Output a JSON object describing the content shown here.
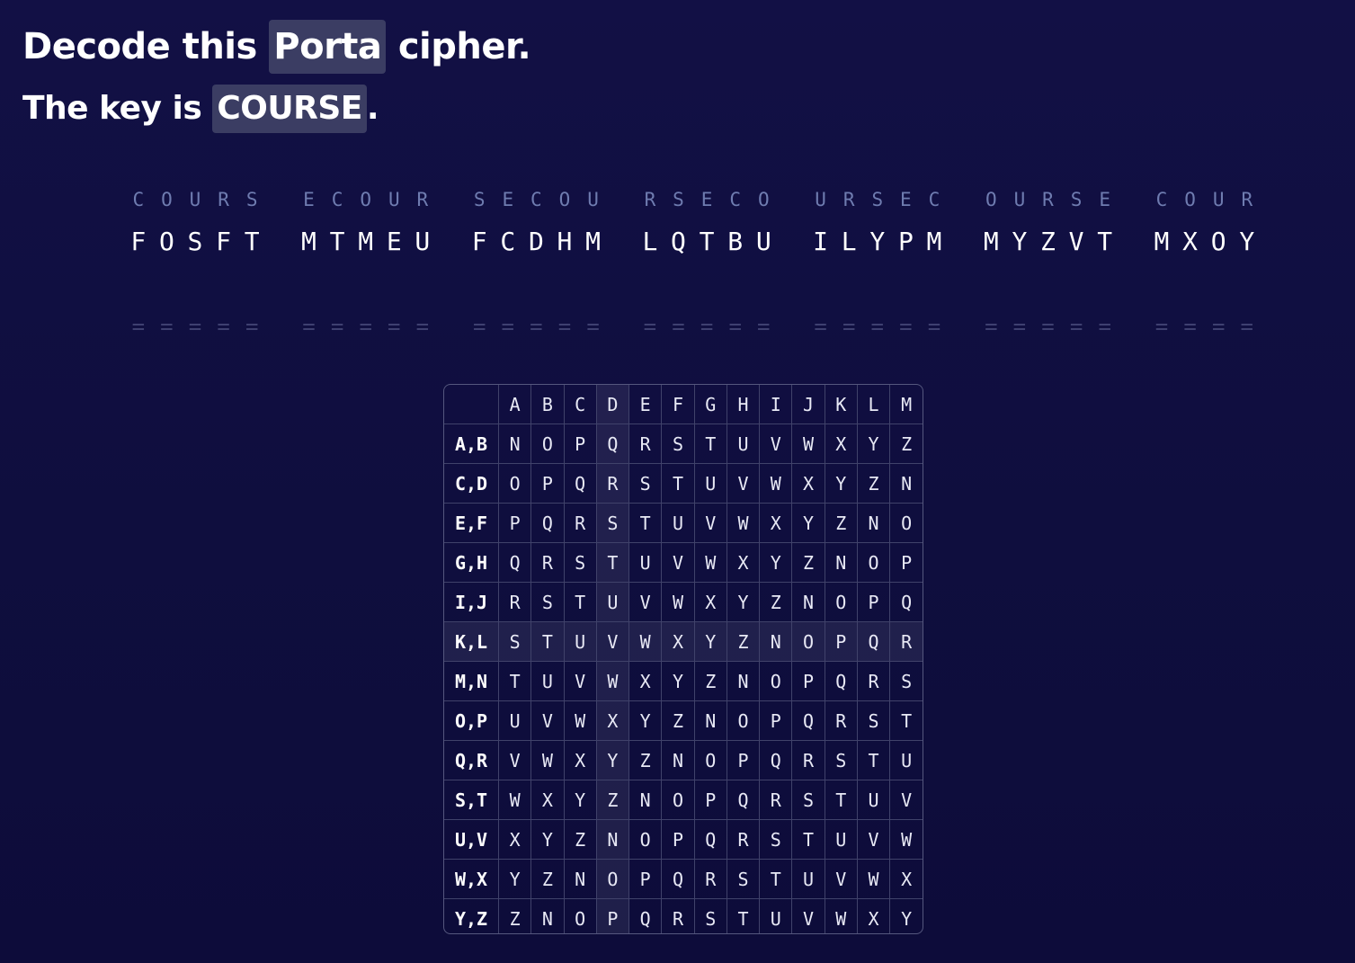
{
  "title": {
    "prefix": "Decode this",
    "cipher_name": "Porta",
    "suffix": "cipher."
  },
  "subtitle": {
    "prefix": "The key is",
    "key": "COURSE",
    "suffix": "."
  },
  "groups": [
    {
      "key": "COURS",
      "ciphertext": "FOSFT",
      "plaintext": "====="
    },
    {
      "key": "ECOUR",
      "ciphertext": "MTMEU",
      "plaintext": "====="
    },
    {
      "key": "SECOU",
      "ciphertext": "FCDHM",
      "plaintext": "====="
    },
    {
      "key": "RSECO",
      "ciphertext": "LQTBU",
      "plaintext": "====="
    },
    {
      "key": "URSEC",
      "ciphertext": "ILYPM",
      "plaintext": "====="
    },
    {
      "key": "OURSE",
      "ciphertext": "MYZVT",
      "plaintext": "====="
    },
    {
      "key": "COUR",
      "ciphertext": "MXOY",
      "plaintext": "===="
    }
  ],
  "tableau": {
    "header": [
      "A",
      "B",
      "C",
      "D",
      "E",
      "F",
      "G",
      "H",
      "I",
      "J",
      "K",
      "L",
      "M"
    ],
    "highlight_column": "D",
    "highlight_row": "K,L",
    "rows": [
      {
        "label": "A,B",
        "cells": [
          "N",
          "O",
          "P",
          "Q",
          "R",
          "S",
          "T",
          "U",
          "V",
          "W",
          "X",
          "Y",
          "Z"
        ]
      },
      {
        "label": "C,D",
        "cells": [
          "O",
          "P",
          "Q",
          "R",
          "S",
          "T",
          "U",
          "V",
          "W",
          "X",
          "Y",
          "Z",
          "N"
        ]
      },
      {
        "label": "E,F",
        "cells": [
          "P",
          "Q",
          "R",
          "S",
          "T",
          "U",
          "V",
          "W",
          "X",
          "Y",
          "Z",
          "N",
          "O"
        ]
      },
      {
        "label": "G,H",
        "cells": [
          "Q",
          "R",
          "S",
          "T",
          "U",
          "V",
          "W",
          "X",
          "Y",
          "Z",
          "N",
          "O",
          "P"
        ]
      },
      {
        "label": "I,J",
        "cells": [
          "R",
          "S",
          "T",
          "U",
          "V",
          "W",
          "X",
          "Y",
          "Z",
          "N",
          "O",
          "P",
          "Q"
        ]
      },
      {
        "label": "K,L",
        "cells": [
          "S",
          "T",
          "U",
          "V",
          "W",
          "X",
          "Y",
          "Z",
          "N",
          "O",
          "P",
          "Q",
          "R"
        ]
      },
      {
        "label": "M,N",
        "cells": [
          "T",
          "U",
          "V",
          "W",
          "X",
          "Y",
          "Z",
          "N",
          "O",
          "P",
          "Q",
          "R",
          "S"
        ]
      },
      {
        "label": "O,P",
        "cells": [
          "U",
          "V",
          "W",
          "X",
          "Y",
          "Z",
          "N",
          "O",
          "P",
          "Q",
          "R",
          "S",
          "T"
        ]
      },
      {
        "label": "Q,R",
        "cells": [
          "V",
          "W",
          "X",
          "Y",
          "Z",
          "N",
          "O",
          "P",
          "Q",
          "R",
          "S",
          "T",
          "U"
        ]
      },
      {
        "label": "S,T",
        "cells": [
          "W",
          "X",
          "Y",
          "Z",
          "N",
          "O",
          "P",
          "Q",
          "R",
          "S",
          "T",
          "U",
          "V"
        ]
      },
      {
        "label": "U,V",
        "cells": [
          "X",
          "Y",
          "Z",
          "N",
          "O",
          "P",
          "Q",
          "R",
          "S",
          "T",
          "U",
          "V",
          "W"
        ]
      },
      {
        "label": "W,X",
        "cells": [
          "Y",
          "Z",
          "N",
          "O",
          "P",
          "Q",
          "R",
          "S",
          "T",
          "U",
          "V",
          "W",
          "X"
        ]
      },
      {
        "label": "Y,Z",
        "cells": [
          "Z",
          "N",
          "O",
          "P",
          "Q",
          "R",
          "S",
          "T",
          "U",
          "V",
          "W",
          "X",
          "Y"
        ]
      }
    ]
  }
}
